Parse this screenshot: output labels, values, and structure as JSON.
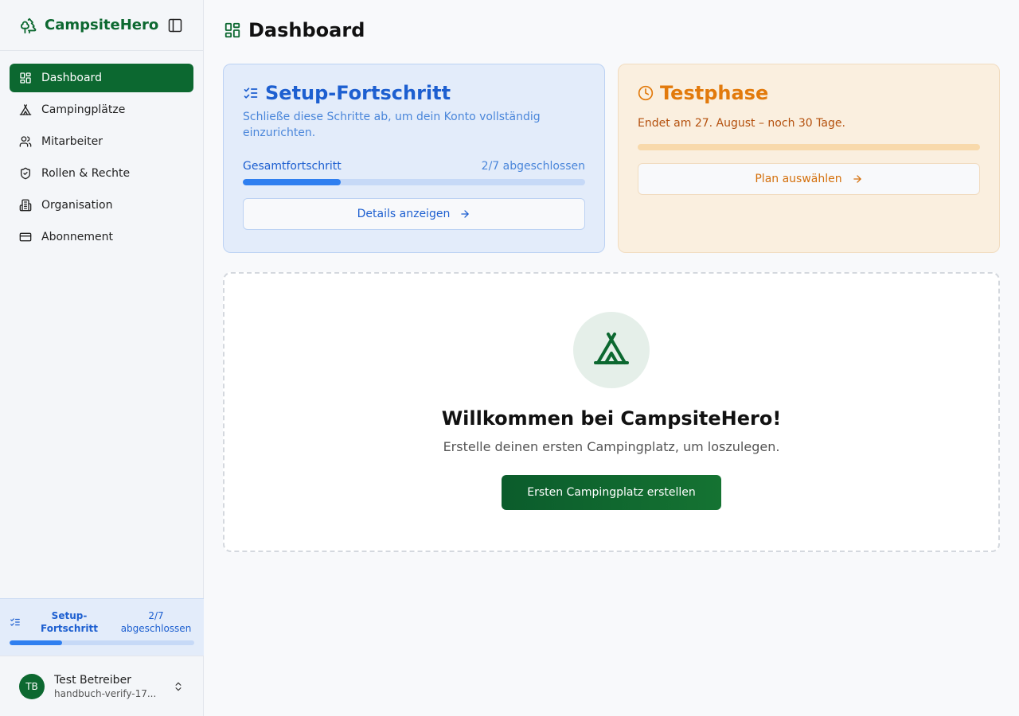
{
  "brand": {
    "name": "CampsiteHero"
  },
  "sidebar": {
    "items": [
      {
        "label": "Dashboard",
        "icon": "dashboard-icon"
      },
      {
        "label": "Campingplätze",
        "icon": "tent-icon"
      },
      {
        "label": "Mitarbeiter",
        "icon": "users-icon"
      },
      {
        "label": "Rollen & Rechte",
        "icon": "shield-icon"
      },
      {
        "label": "Organisation",
        "icon": "building-icon"
      },
      {
        "label": "Abonnement",
        "icon": "credit-card-icon"
      }
    ],
    "progress": {
      "label": "Setup-Fortschritt",
      "count": "2/7 abgeschlossen",
      "value": 0.2857
    }
  },
  "user": {
    "initials": "TB",
    "name": "Test Betreiber",
    "email": "handbuch-verify-17..."
  },
  "page": {
    "title": "Dashboard"
  },
  "setup_card": {
    "title": "Setup-Fortschritt",
    "description": "Schließe diese Schritte ab, um dein Konto vollständig einzurichten.",
    "progress_label": "Gesamtfortschritt",
    "progress_count": "2/7 abgeschlossen",
    "progress_value": 0.2857,
    "button_label": "Details anzeigen"
  },
  "trial_card": {
    "title": "Testphase",
    "description": "Endet am 27. August – noch 30 Tage.",
    "progress_value": 0.0,
    "button_label": "Plan auswählen"
  },
  "empty_state": {
    "title": "Willkommen bei CampsiteHero!",
    "subtitle": "Erstelle deinen ersten Campingplatz, um loszulegen.",
    "button_label": "Ersten Campingplatz erstellen"
  },
  "colors": {
    "brand_green": "#0c6830",
    "setup_blue": "#1d5fd0",
    "trial_orange": "#e27a0c"
  }
}
